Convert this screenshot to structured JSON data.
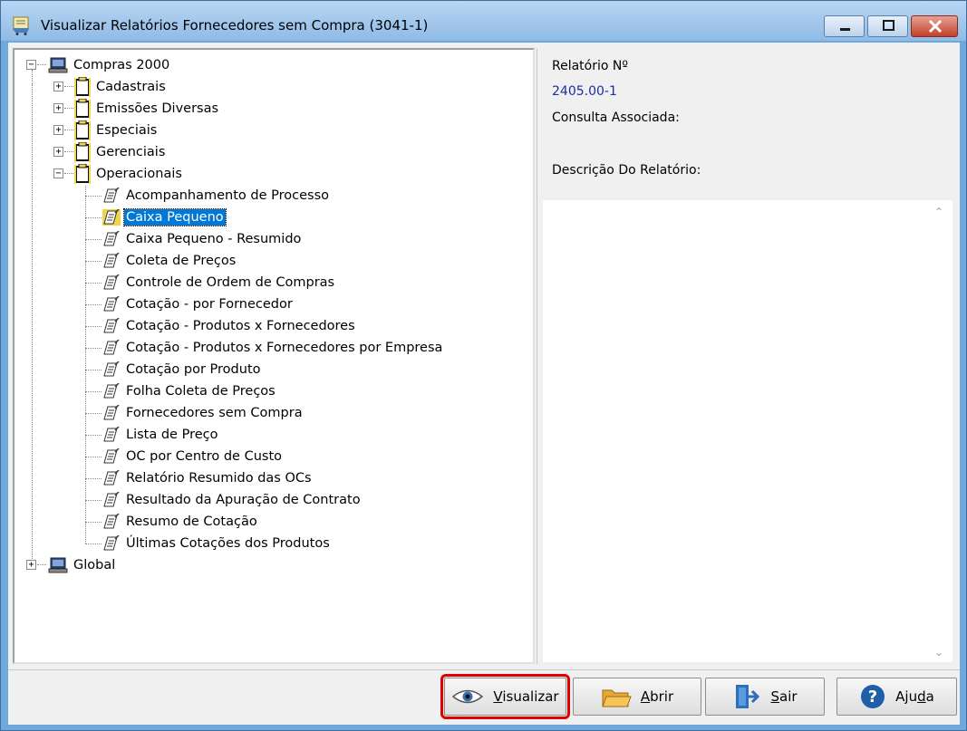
{
  "window": {
    "title": "Visualizar Relatórios Fornecedores sem Compra (3041-1)"
  },
  "tree": {
    "root": "Compras 2000",
    "folders": [
      "Cadastrais",
      "Emissões Diversas",
      "Especiais",
      "Gerenciais",
      "Operacionais"
    ],
    "operacionais_items": [
      "Acompanhamento de Processo",
      "Caixa Pequeno",
      "Caixa Pequeno - Resumido",
      "Coleta de Preços",
      "Controle de Ordem de Compras",
      "Cotação - por Fornecedor",
      "Cotação - Produtos x Fornecedores",
      "Cotação - Produtos x Fornecedores por Empresa",
      "Cotação por Produto",
      "Folha Coleta de Preços",
      "Fornecedores sem Compra",
      "Lista de Preço",
      "OC por Centro de Custo",
      "Relatório Resumido das OCs",
      "Resultado da Apuração de Contrato",
      "Resumo de Cotação",
      "Últimas Cotações dos Produtos"
    ],
    "selected": "Caixa Pequeno",
    "global": "Global"
  },
  "info": {
    "report_no_label": "Relatório Nº",
    "report_no_value": "2405.00-1",
    "consulta_label": "Consulta Associada:",
    "descricao_label": "Descrição Do Relatório:"
  },
  "buttons": {
    "visualizar": {
      "pre": "",
      "key": "V",
      "post": "isualizar"
    },
    "abrir": {
      "pre": "",
      "key": "A",
      "post": "brir"
    },
    "sair": {
      "pre": "",
      "key": "S",
      "post": "air"
    },
    "ajuda": {
      "pre": "Aju",
      "key": "d",
      "post": "a"
    }
  },
  "icons": {
    "app": "report-cart-icon",
    "computer": "computer-icon",
    "folder": "clipboard-folder-icon",
    "report": "report-document-icon",
    "eye": "eye-icon",
    "open": "folder-open-icon",
    "exit": "exit-door-icon",
    "help": "help-circle-icon"
  },
  "colors": {
    "selection": "#0078d7",
    "highlight_border": "#e00000",
    "report_value": "#1a2ea0"
  }
}
